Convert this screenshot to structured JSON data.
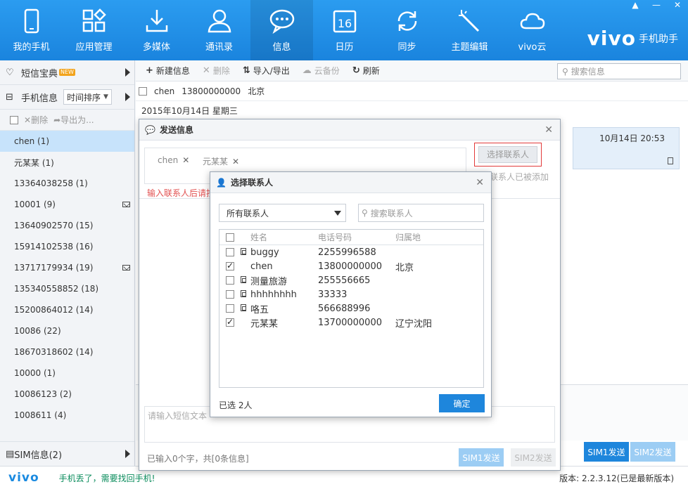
{
  "nav": [
    {
      "label": "我的手机",
      "icon": "phone-icon"
    },
    {
      "label": "应用管理",
      "icon": "apps-icon"
    },
    {
      "label": "多媒体",
      "icon": "download-icon"
    },
    {
      "label": "通讯录",
      "icon": "contact-icon"
    },
    {
      "label": "信息",
      "icon": "message-icon"
    },
    {
      "label": "日历",
      "icon": "calendar-icon"
    },
    {
      "label": "同步",
      "icon": "sync-icon"
    },
    {
      "label": "主题编辑",
      "icon": "wand-icon"
    },
    {
      "label": "vivo云",
      "icon": "cloud-icon"
    }
  ],
  "calendar_day": "16",
  "window_controls": {
    "pin": "▲",
    "minimize": "—",
    "close": "✕"
  },
  "brand": {
    "logo": "vivo",
    "subtitle": "手机助手"
  },
  "sidebar": {
    "treasure_label": "短信宝典",
    "new_badge": "NEW",
    "phone_info_label": "手机信息",
    "sort_label": "时间排序",
    "delete_label": "删除",
    "export_label": "导出为...",
    "conversations": [
      {
        "label": "chen (1)",
        "mail": false
      },
      {
        "label": "元某某 (1)",
        "mail": false
      },
      {
        "label": "13364038258 (1)",
        "mail": false
      },
      {
        "label": "10001 (9)",
        "mail": true
      },
      {
        "label": "13640902570 (15)",
        "mail": false
      },
      {
        "label": "15914102538 (16)",
        "mail": false
      },
      {
        "label": "13717179934 (19)",
        "mail": true
      },
      {
        "label": "135340558852 (18)",
        "mail": false
      },
      {
        "label": "15200864012 (14)",
        "mail": false
      },
      {
        "label": "10086 (22)",
        "mail": false
      },
      {
        "label": "18670318602 (14)",
        "mail": false
      },
      {
        "label": "10000 (1)",
        "mail": false
      },
      {
        "label": "10086123 (2)",
        "mail": false
      },
      {
        "label": "1008611 (4)",
        "mail": false
      }
    ],
    "sim_info_label": "SIM信息(2)"
  },
  "toolbar": {
    "new_label": "新建信息",
    "delete_label": "删除",
    "import_export_label": "导入/导出",
    "cloud_backup_label": "云备份",
    "refresh_label": "刷新",
    "search_placeholder": "搜索信息"
  },
  "conversation": {
    "name": "chen",
    "number": "13800000000",
    "location": "北京",
    "date": "2015年10月14日 星期三",
    "bubble_time": "10月14日 20:53"
  },
  "main_send": {
    "sim1": "SIM1发送",
    "sim2": "SIM2发送"
  },
  "status": {
    "logo": "vivo",
    "lost_phone": "手机丢了，需要找回手机!",
    "version": "版本: 2.2.3.12(已是最新版本)"
  },
  "send_dialog": {
    "title": "发送信息",
    "chips": [
      "chen",
      "元某某"
    ],
    "choose_button": "选择联系人",
    "added_hint": "联系人已被添加",
    "error_hint": "输入联系人后请按",
    "text_placeholder": "请输入短信文本",
    "count_hint": "已输入0个字，共[0条信息]",
    "sim1": "SIM1发送",
    "sim2": "SIM2发送"
  },
  "contact_dialog": {
    "title": "选择联系人",
    "group_select": "所有联系人",
    "search_placeholder": "搜索联系人",
    "columns": {
      "name": "姓名",
      "phone": "电话号码",
      "location": "归属地"
    },
    "rows": [
      {
        "name": "buggy",
        "phone": "2255996588",
        "location": "",
        "checked": false,
        "sim": true
      },
      {
        "name": "chen",
        "phone": "13800000000",
        "location": "北京",
        "checked": true,
        "sim": false
      },
      {
        "name": "测量旅游",
        "phone": "255556665",
        "location": "",
        "checked": false,
        "sim": true
      },
      {
        "name": "hhhhhhhh",
        "phone": "33333",
        "location": "",
        "checked": false,
        "sim": true
      },
      {
        "name": "咯五",
        "phone": "566688996",
        "location": "",
        "checked": false,
        "sim": true
      },
      {
        "name": "元某某",
        "phone": "13700000000",
        "location": "辽宁沈阳",
        "checked": true,
        "sim": false
      }
    ],
    "selected_count": "已选 2人",
    "ok_button": "确定"
  }
}
